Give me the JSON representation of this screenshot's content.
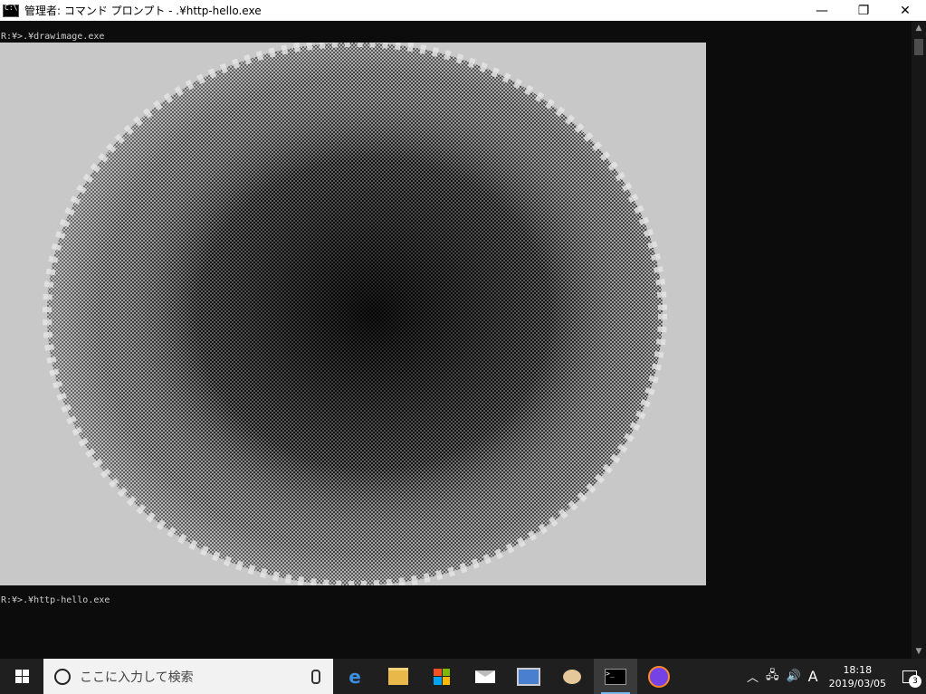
{
  "window": {
    "title": "管理者: コマンド プロンプト - .¥http-hello.exe",
    "minimize_glyph": "—",
    "maximize_glyph": "❐",
    "close_glyph": "✕"
  },
  "console": {
    "line1": "R:¥>.¥drawimage.exe",
    "line2": "R:¥>.¥http-hello.exe"
  },
  "taskbar": {
    "search_placeholder": "ここに入力して検索",
    "pinned": [
      "edge-icon",
      "file-explorer-icon",
      "store-icon",
      "mail-icon",
      "remote-desktop-icon",
      "paint-icon",
      "command-prompt-icon",
      "firefox-icon"
    ],
    "ime_indicator": "A",
    "time": "18:18",
    "date": "2019/03/05",
    "notification_count": "3"
  },
  "colors": {
    "console_bg": "#0c0c0c",
    "console_fg": "#cccccc",
    "taskbar_bg": "#1f1f1f",
    "accent": "#76b9ed"
  }
}
